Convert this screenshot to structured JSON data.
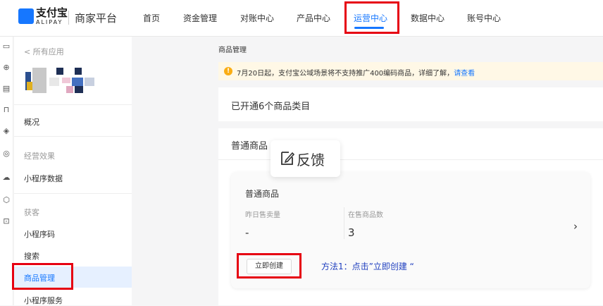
{
  "brand": {
    "logo_text": "支付宝",
    "logo_sub": "ALIPAY",
    "platform": "商家平台",
    "color": "#1677ff"
  },
  "nav": {
    "items": [
      {
        "label": "首页"
      },
      {
        "label": "资金管理"
      },
      {
        "label": "对账中心"
      },
      {
        "label": "产品中心"
      },
      {
        "label": "运营中心"
      },
      {
        "label": "数据中心"
      },
      {
        "label": "账号中心"
      }
    ],
    "active": "运营中心"
  },
  "rail_icons": [
    "monitor-icon",
    "circle-plus-icon",
    "document-icon",
    "bag-icon",
    "box-icon",
    "target-icon",
    "cloud-icon",
    "shield-icon",
    "message-icon"
  ],
  "sidebar": {
    "back_link": "< 所有应用",
    "overview": "概况",
    "section_ops": "经营效果",
    "miniapp_data": "小程序数据",
    "section_acquire": "获客",
    "miniapp_code": "小程序码",
    "search": "搜索",
    "product_mgmt": "商品管理",
    "miniapp_service": "小程序服务"
  },
  "main": {
    "breadcrumb": "商品管理",
    "notice": {
      "text": "7月20日起，支付宝公域场景将不支持推广400编码商品，详细了解，",
      "link": "请查看"
    },
    "categories_title": "已开通6个商品类目",
    "normal_section_title": "普通商品",
    "card": {
      "title": "普通商品",
      "stat1_label": "昨日售卖量",
      "stat1_value": "-",
      "stat2_label": "在售商品数",
      "stat2_value": "3",
      "create_button": "立即创建"
    },
    "annotation": "方法1：点击”立即创建 “"
  },
  "feedback": {
    "label": "反馈"
  },
  "colors": {
    "highlight_red": "#e60012",
    "link_blue": "#1677ff",
    "notice_bg": "#fff8e6",
    "annotation_blue": "#1f3fbf"
  }
}
